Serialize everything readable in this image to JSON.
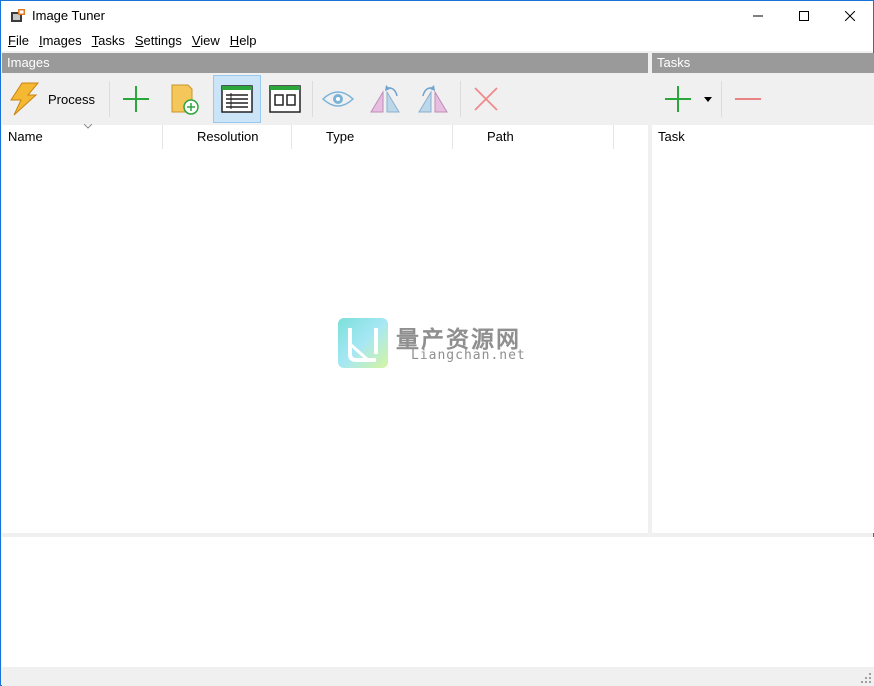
{
  "window": {
    "title": "Image Tuner"
  },
  "menu": {
    "items": [
      "File",
      "Images",
      "Tasks",
      "Settings",
      "View",
      "Help"
    ]
  },
  "images_panel": {
    "header": "Images",
    "toolbar": {
      "process_label": "Process"
    },
    "columns": [
      "Name",
      "Resolution",
      "Type",
      "Path"
    ],
    "rows": []
  },
  "tasks_panel": {
    "header": "Tasks",
    "columns": [
      "Task"
    ],
    "rows": []
  },
  "watermark": {
    "cn_text": "量产资源网",
    "en_text": "Liangchan.net"
  },
  "colors": {
    "accent": "#1a73d9",
    "header_bg": "#9a9a9a",
    "active_tool": "#cce4f7",
    "add_green": "#2aa63a",
    "remove_red": "#e86060"
  }
}
